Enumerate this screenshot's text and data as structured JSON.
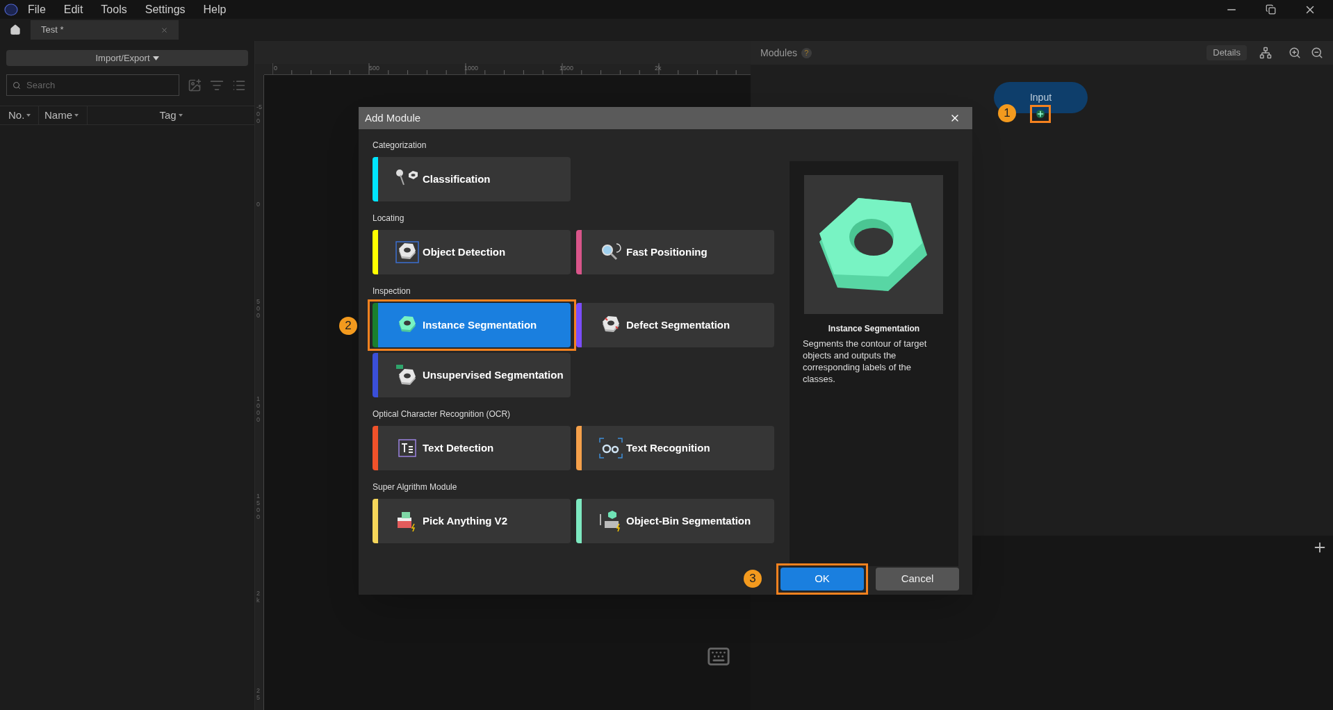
{
  "menu_bar": {
    "items": [
      "File",
      "Edit",
      "Tools",
      "Settings",
      "Help"
    ]
  },
  "tabs": [
    {
      "label": "Test *",
      "selected": true
    }
  ],
  "left_panel": {
    "import_export": "Import/Export",
    "search": {
      "placeholder": "Search"
    },
    "columns": [
      "No.",
      "Name",
      "Tag"
    ]
  },
  "ruler": {
    "horizontal": [
      "0",
      "500",
      "1000",
      "1500",
      "2k"
    ],
    "vertical": [
      "-500",
      "0",
      "500",
      "1000",
      "1500",
      "2k",
      "25"
    ]
  },
  "modules_panel": {
    "title": "Modules",
    "help": "?",
    "details": "Details",
    "input_node": {
      "label": "Input",
      "callout": "1"
    }
  },
  "dialog": {
    "title": "Add Module",
    "sections": [
      {
        "heading": "Categorization",
        "items": [
          {
            "label": "Classification",
            "color": "#00e5ff",
            "selected": false
          }
        ]
      },
      {
        "heading": "Locating",
        "items": [
          {
            "label": "Object Detection",
            "color": "#ffff00",
            "selected": false
          },
          {
            "label": "Fast Positioning",
            "color": "#d9558a",
            "selected": false
          }
        ]
      },
      {
        "heading": "Inspection",
        "items": [
          {
            "label": "Instance Segmentation",
            "color": "#1a7f2e",
            "selected": true,
            "callout": "2"
          },
          {
            "label": "Defect Segmentation",
            "color": "#7b4dff",
            "selected": false
          },
          {
            "label": "Unsupervised Segmentation",
            "color": "#3a4fd9",
            "selected": false
          }
        ]
      },
      {
        "heading": "Optical Character Recognition (OCR)",
        "items": [
          {
            "label": "Text Detection",
            "color": "#f0522a",
            "selected": false
          },
          {
            "label": "Text Recognition",
            "color": "#f5a04a",
            "selected": false
          }
        ]
      },
      {
        "heading": "Super Algrithm Module",
        "items": [
          {
            "label": "Pick Anything V2",
            "color": "#f5d65a",
            "selected": false
          },
          {
            "label": "Object-Bin Segmentation",
            "color": "#7de8c0",
            "selected": false
          }
        ]
      }
    ],
    "preview": {
      "title": "Instance Segmentation",
      "description": "Segments the contour of target objects and outputs the corresponding labels of the classes."
    },
    "buttons": [
      {
        "label": "OK",
        "kind": "primary",
        "callout": "3"
      },
      {
        "label": "Cancel",
        "kind": "secondary"
      }
    ]
  }
}
